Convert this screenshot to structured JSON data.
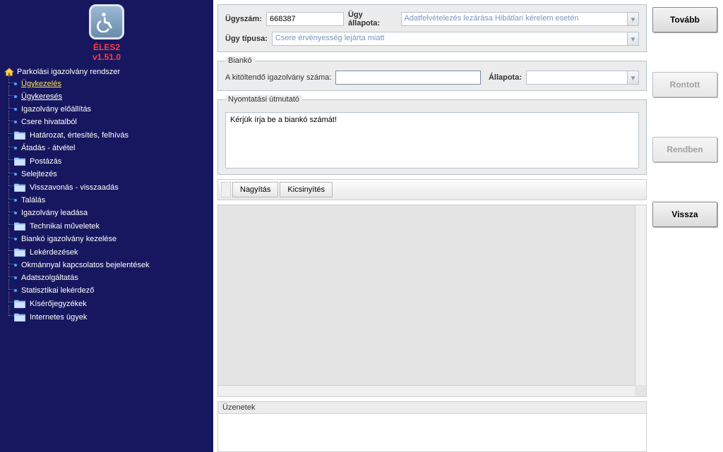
{
  "app": {
    "title": "ÉLES2",
    "version": "v1.51.0"
  },
  "nav": {
    "root_label": "Parkolási igazolvány rendszer",
    "items": [
      {
        "type": "leaf",
        "label": "Ügykezelés",
        "active": true,
        "under": true
      },
      {
        "type": "leaf",
        "label": "Ügykeresés",
        "under": true
      },
      {
        "type": "leaf",
        "label": "Igazolvány előállítás"
      },
      {
        "type": "leaf",
        "label": "Csere hivatalból"
      },
      {
        "type": "folder",
        "label": "Határozat, értesítés, felhívás"
      },
      {
        "type": "leaf",
        "label": "Átadás - átvétel"
      },
      {
        "type": "folder",
        "label": "Postázás"
      },
      {
        "type": "leaf",
        "label": "Selejtezés"
      },
      {
        "type": "folder",
        "label": "Visszavonás - visszaadás"
      },
      {
        "type": "leaf",
        "label": "Találás"
      },
      {
        "type": "leaf",
        "label": "Igazolvány leadása"
      },
      {
        "type": "folder",
        "label": "Technikai műveletek"
      },
      {
        "type": "leaf",
        "label": "Biankó igazolvány kezelése"
      },
      {
        "type": "folder",
        "label": "Lekérdezések"
      },
      {
        "type": "leaf",
        "label": "Okmánnyal kapcsolatos bejelentések"
      },
      {
        "type": "leaf",
        "label": "Adatszolgáltatás"
      },
      {
        "type": "leaf",
        "label": "Statisztikai lekérdező"
      },
      {
        "type": "folder",
        "label": "Kísérőjegyzékek"
      },
      {
        "type": "folder",
        "label": "Internetes ügyek"
      }
    ]
  },
  "case": {
    "label_number": "Ügyszám:",
    "number": "668387",
    "label_status": "Ügy állapota:",
    "status_value": "Adatfelvételezés lezárása Hibátlan kérelem esetén",
    "label_type": "Ügy típusa:",
    "type_value": "Csere érvényesség lejárta miatt"
  },
  "bianko": {
    "legend": "Biankó",
    "label_number": "A kitöltendő igazolvány száma:",
    "number_value": "",
    "label_status": "Állapota:",
    "status_value": ""
  },
  "print_guide": {
    "legend": "Nyomtatási útmutató",
    "text": "Kérjük írja be a biankó számát!"
  },
  "zoom": {
    "in_label": "Nagyítás",
    "out_label": "Kicsinyítés"
  },
  "messages": {
    "header": "Üzenetek"
  },
  "buttons": {
    "next": "Tovább",
    "fail": "Rontott",
    "ok": "Rendben",
    "back": "Vissza"
  }
}
